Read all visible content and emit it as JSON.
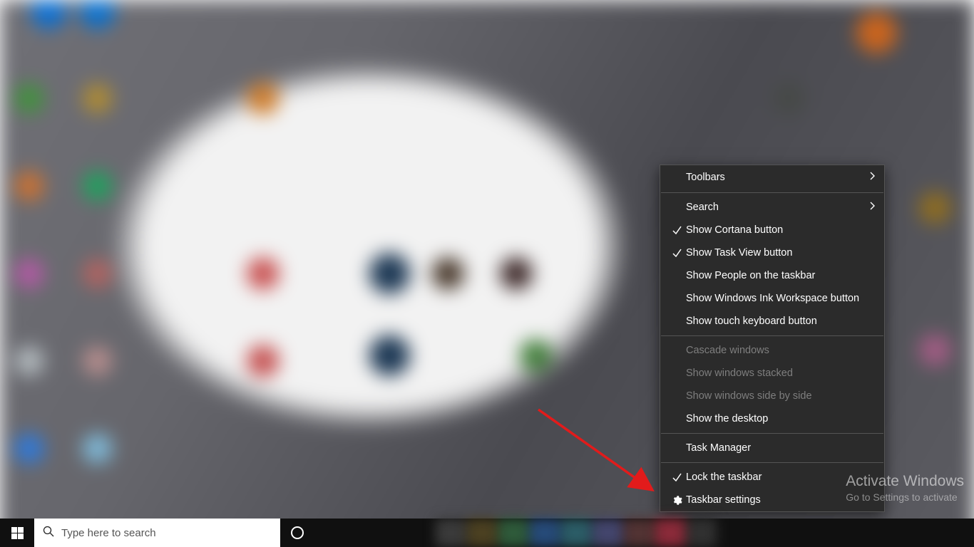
{
  "desktop": {
    "wallpaper_desc": "blurred grayscale abstract with many blurred desktop icon blobs"
  },
  "taskbar": {
    "search_placeholder": "Type here to search"
  },
  "watermark": {
    "title": "Activate Windows",
    "sub": "Go to Settings to activate"
  },
  "annotation": {
    "arrow_target": "Taskbar settings"
  },
  "context_menu": {
    "groups": [
      {
        "items": [
          {
            "id": "toolbars",
            "label": "Toolbars",
            "submenu": true
          }
        ]
      },
      {
        "items": [
          {
            "id": "search",
            "label": "Search",
            "submenu": true
          },
          {
            "id": "show-cortana",
            "label": "Show Cortana button",
            "checked": true
          },
          {
            "id": "show-taskview",
            "label": "Show Task View button",
            "checked": true
          },
          {
            "id": "show-people",
            "label": "Show People on the taskbar"
          },
          {
            "id": "show-ink",
            "label": "Show Windows Ink Workspace button"
          },
          {
            "id": "show-touchkb",
            "label": "Show touch keyboard button"
          }
        ]
      },
      {
        "items": [
          {
            "id": "cascade",
            "label": "Cascade windows",
            "disabled": true
          },
          {
            "id": "stacked",
            "label": "Show windows stacked",
            "disabled": true
          },
          {
            "id": "sidebyside",
            "label": "Show windows side by side",
            "disabled": true
          },
          {
            "id": "showdesktop",
            "label": "Show the desktop"
          }
        ]
      },
      {
        "items": [
          {
            "id": "taskmgr",
            "label": "Task Manager"
          }
        ]
      },
      {
        "items": [
          {
            "id": "locktb",
            "label": "Lock the taskbar",
            "checked": true
          },
          {
            "id": "tbsettings",
            "label": "Taskbar settings",
            "icon": "gear"
          }
        ]
      }
    ]
  }
}
